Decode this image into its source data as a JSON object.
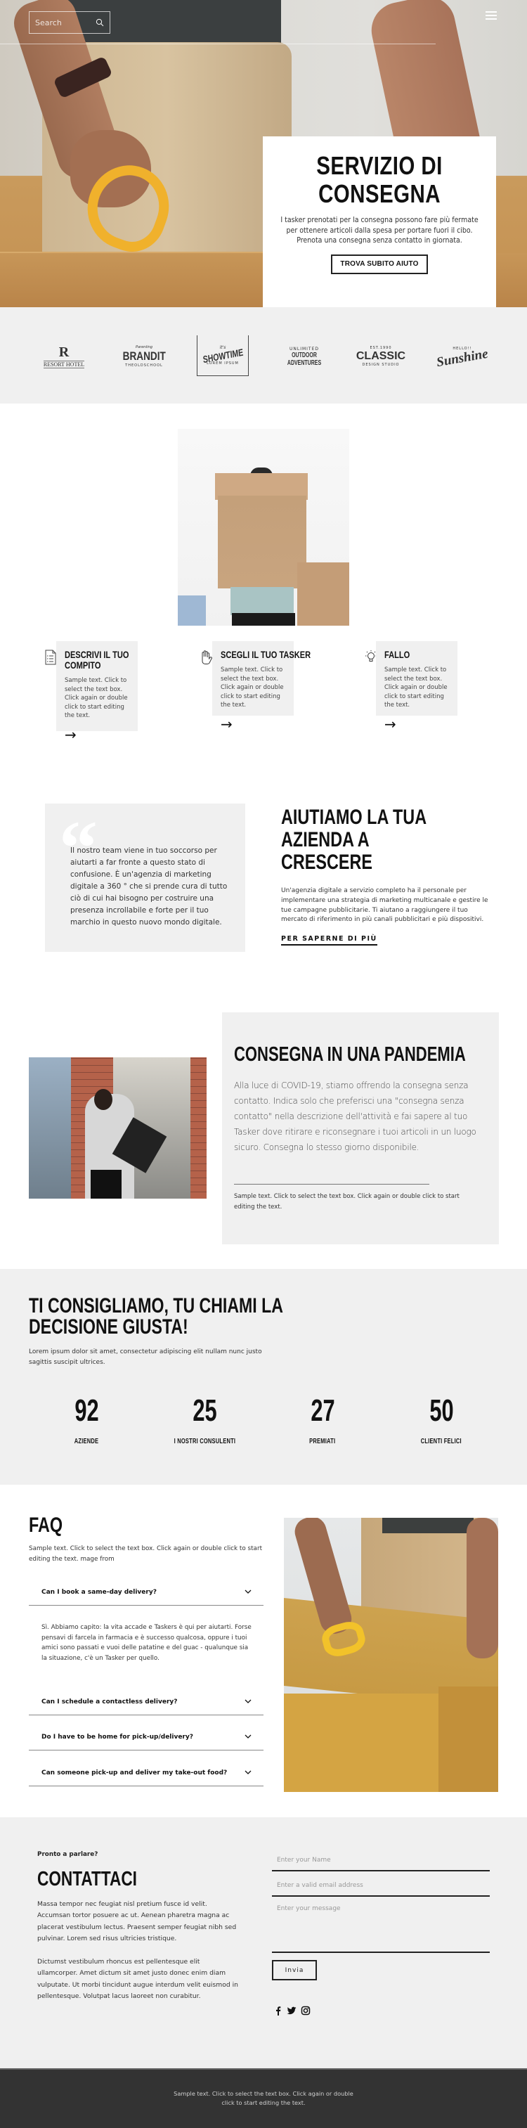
{
  "header": {
    "search_placeholder": "Search",
    "search_icon": "search-icon",
    "menu_icon": "hamburger-menu-icon"
  },
  "hero": {
    "title": "SERVIZIO DI CONSEGNA",
    "text": "I tasker prenotati per la consegna possono fare più fermate per ottenere articoli dalla spesa per portare fuori il cibo. Prenota una consegna senza contatto in giornata.",
    "button": "TROVA SUBITO AIUTO"
  },
  "logos": [
    {
      "name": "RESORT HOTEL",
      "mark": "R"
    },
    {
      "name": "BRANDIT",
      "tag": "THEOLDSCHOOL",
      "top": "Parenting"
    },
    {
      "name": "SHOWTIME",
      "tag": "LOREM IPSUM",
      "top": "it's"
    },
    {
      "name": "OUTDOOR ADVENTURES",
      "top": "UNLIMITED"
    },
    {
      "name": "CLASSIC",
      "tag": "DESIGN STUDIO",
      "top": "EST.1990"
    },
    {
      "name": "Sunshine",
      "top": "HELLO!!"
    }
  ],
  "steps": [
    {
      "icon": "document-checklist-icon",
      "title": "DESCRIVI IL TUO COMPITO",
      "text": "Sample text. Click to select the text box. Click again or double click to start editing the text.",
      "arrow": "→"
    },
    {
      "icon": "hand-icon",
      "title": "SCEGLI IL TUO TASKER",
      "text": "Sample text. Click to select the text box. Click again or double click to start editing the text.",
      "arrow": "→"
    },
    {
      "icon": "lightbulb-icon",
      "title": "FALLO",
      "text": "Sample text. Click to select the text box. Click again or double click to start editing the text.",
      "arrow": "→"
    }
  ],
  "quote": {
    "mark": "“",
    "text": "Il nostro team viene in tuo soccorso per aiutarti a far fronte a questo stato di confusione. È un'agenzia di marketing digitale a 360 ° che si prende cura di tutto ciò di cui hai bisogno per costruire una presenza incrollabile e forte per il tuo marchio in questo nuovo mondo digitale."
  },
  "grow": {
    "title": "AIUTIAMO LA TUA AZIENDA A CRESCERE",
    "text": "Un'agenzia digitale a servizio completo ha il personale per implementare una strategia di marketing multicanale e gestire le tue campagne pubblicitarie. Ti aiutano a raggiungere il tuo mercato di riferimento in più canali pubblicitari e più dispositivi.",
    "link": "PER SAPERNE DI PIÙ"
  },
  "pandemic": {
    "title": "CONSEGNA IN UNA PANDEMIA",
    "text": "Alla luce di COVID-19, stiamo offrendo la consegna senza contatto. Indica solo che preferisci una \"consegna senza contatto\" nella descrizione dell'attività e fai sapere al tuo Tasker dove ritirare e riconsegnare i tuoi articoli in un luogo sicuro. Consegna lo stesso giorno disponibile.",
    "small": "Sample text. Click to select the text box. Click again or double click to start editing the text."
  },
  "stats": {
    "title": "TI CONSIGLIAMO, TU CHIAMI LA DECISIONE GIUSTA!",
    "subtitle": "Lorem ipsum dolor sit amet, consectetur adipiscing elit nullam nunc justo sagittis suscipit ultrices.",
    "items": [
      {
        "value": "92",
        "label": "AZIENDE"
      },
      {
        "value": "25",
        "label": "I NOSTRI CONSULENTI"
      },
      {
        "value": "27",
        "label": "PREMIATI"
      },
      {
        "value": "50",
        "label": "CLIENTI FELICI"
      }
    ]
  },
  "faq": {
    "title": "FAQ",
    "description": "Sample text. Click to select the text box. Click again or double click to start editing the text. mage from",
    "items": [
      {
        "question": "Can I book a same-day delivery?",
        "answer": "Sì. Abbiamo capito: la vita accade e Taskers è qui per aiutarti. Forse pensavi di farcela in farmacia e è successo qualcosa, oppure i tuoi amici sono passati e vuoi delle patatine e del guac - qualunque sia la situazione, c'è un Tasker per quello.",
        "expanded": true
      },
      {
        "question": "Can I schedule a contactless delivery?",
        "expanded": false
      },
      {
        "question": "Do I have to be home for pick-up/delivery?",
        "expanded": false
      },
      {
        "question": "Can someone pick-up and deliver my take-out food?",
        "expanded": false
      }
    ]
  },
  "contact": {
    "pre_title": "Pronto a parlare?",
    "title": "CONTATTACI",
    "paragraph1": "Massa tempor nec feugiat nisl pretium fusce id velit. Accumsan tortor posuere ac ut. Aenean pharetra magna ac placerat vestibulum lectus. Praesent semper feugiat nibh sed pulvinar. Lorem sed risus ultricies tristique.",
    "paragraph2": "Dictumst vestibulum rhoncus est pellentesque elit ullamcorper. Amet dictum sit amet justo donec enim diam vulputate. Ut morbi tincidunt augue interdum velit euismod in pellentesque. Volutpat lacus laoreet non curabitur.",
    "name_placeholder": "Enter your Name",
    "email_placeholder": "Enter a valid email address",
    "message_placeholder": "Enter your message",
    "submit": "Invia",
    "social": [
      "facebook-icon",
      "twitter-icon",
      "instagram-icon"
    ]
  },
  "footer": {
    "text": "Sample text. Click to select the text box. Click again or double click to start editing the text."
  }
}
